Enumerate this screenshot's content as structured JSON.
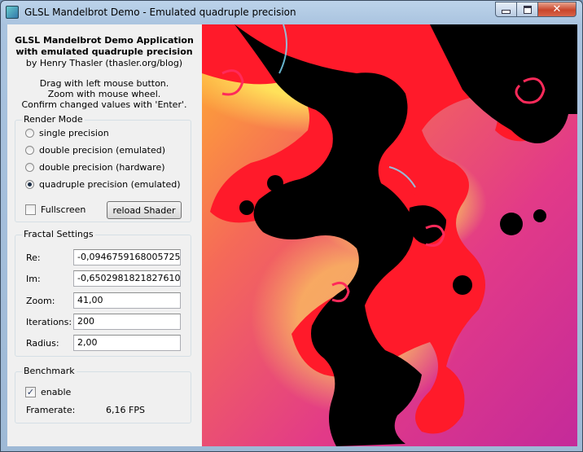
{
  "window": {
    "title": "GLSL Mandelbrot Demo - Emulated quadruple precision"
  },
  "intro": {
    "line1": "GLSL Mandelbrot Demo Application",
    "line2": "with emulated quadruple precision",
    "line3": "by Henry Thasler (thasler.org/blog)",
    "help1": "Drag with left mouse button.",
    "help2": "Zoom with mouse wheel.",
    "help3": "Confirm changed values with 'Enter'."
  },
  "render_mode": {
    "title": "Render Mode",
    "options": [
      {
        "label": "single precision",
        "selected": false
      },
      {
        "label": "double precision (emulated)",
        "selected": false
      },
      {
        "label": "double precision (hardware)",
        "selected": false
      },
      {
        "label": "quadruple precision (emulated)",
        "selected": true
      }
    ],
    "fullscreen_label": "Fullscreen",
    "fullscreen_checked": false,
    "reload_label": "reload Shader"
  },
  "fractal_settings": {
    "title": "Fractal Settings",
    "re_label": "Re:",
    "re_value": "-0,0946759168005725",
    "im_label": "Im:",
    "im_value": "-0,6502981821827610",
    "zoom_label": "Zoom:",
    "zoom_value": "41,00",
    "iter_label": "Iterations:",
    "iter_value": "200",
    "radius_label": "Radius:",
    "radius_value": "2,00"
  },
  "benchmark": {
    "title": "Benchmark",
    "enable_label": "enable",
    "enable_checked": true,
    "check_glyph": "✓",
    "framerate_label": "Framerate:",
    "framerate_value": "6,16 FPS"
  },
  "colors": {
    "fractal_background": "#e0207a",
    "fractal_set": "#000000",
    "fractal_filament": "#ff1a2a",
    "fractal_halo": "#ffd24a"
  }
}
